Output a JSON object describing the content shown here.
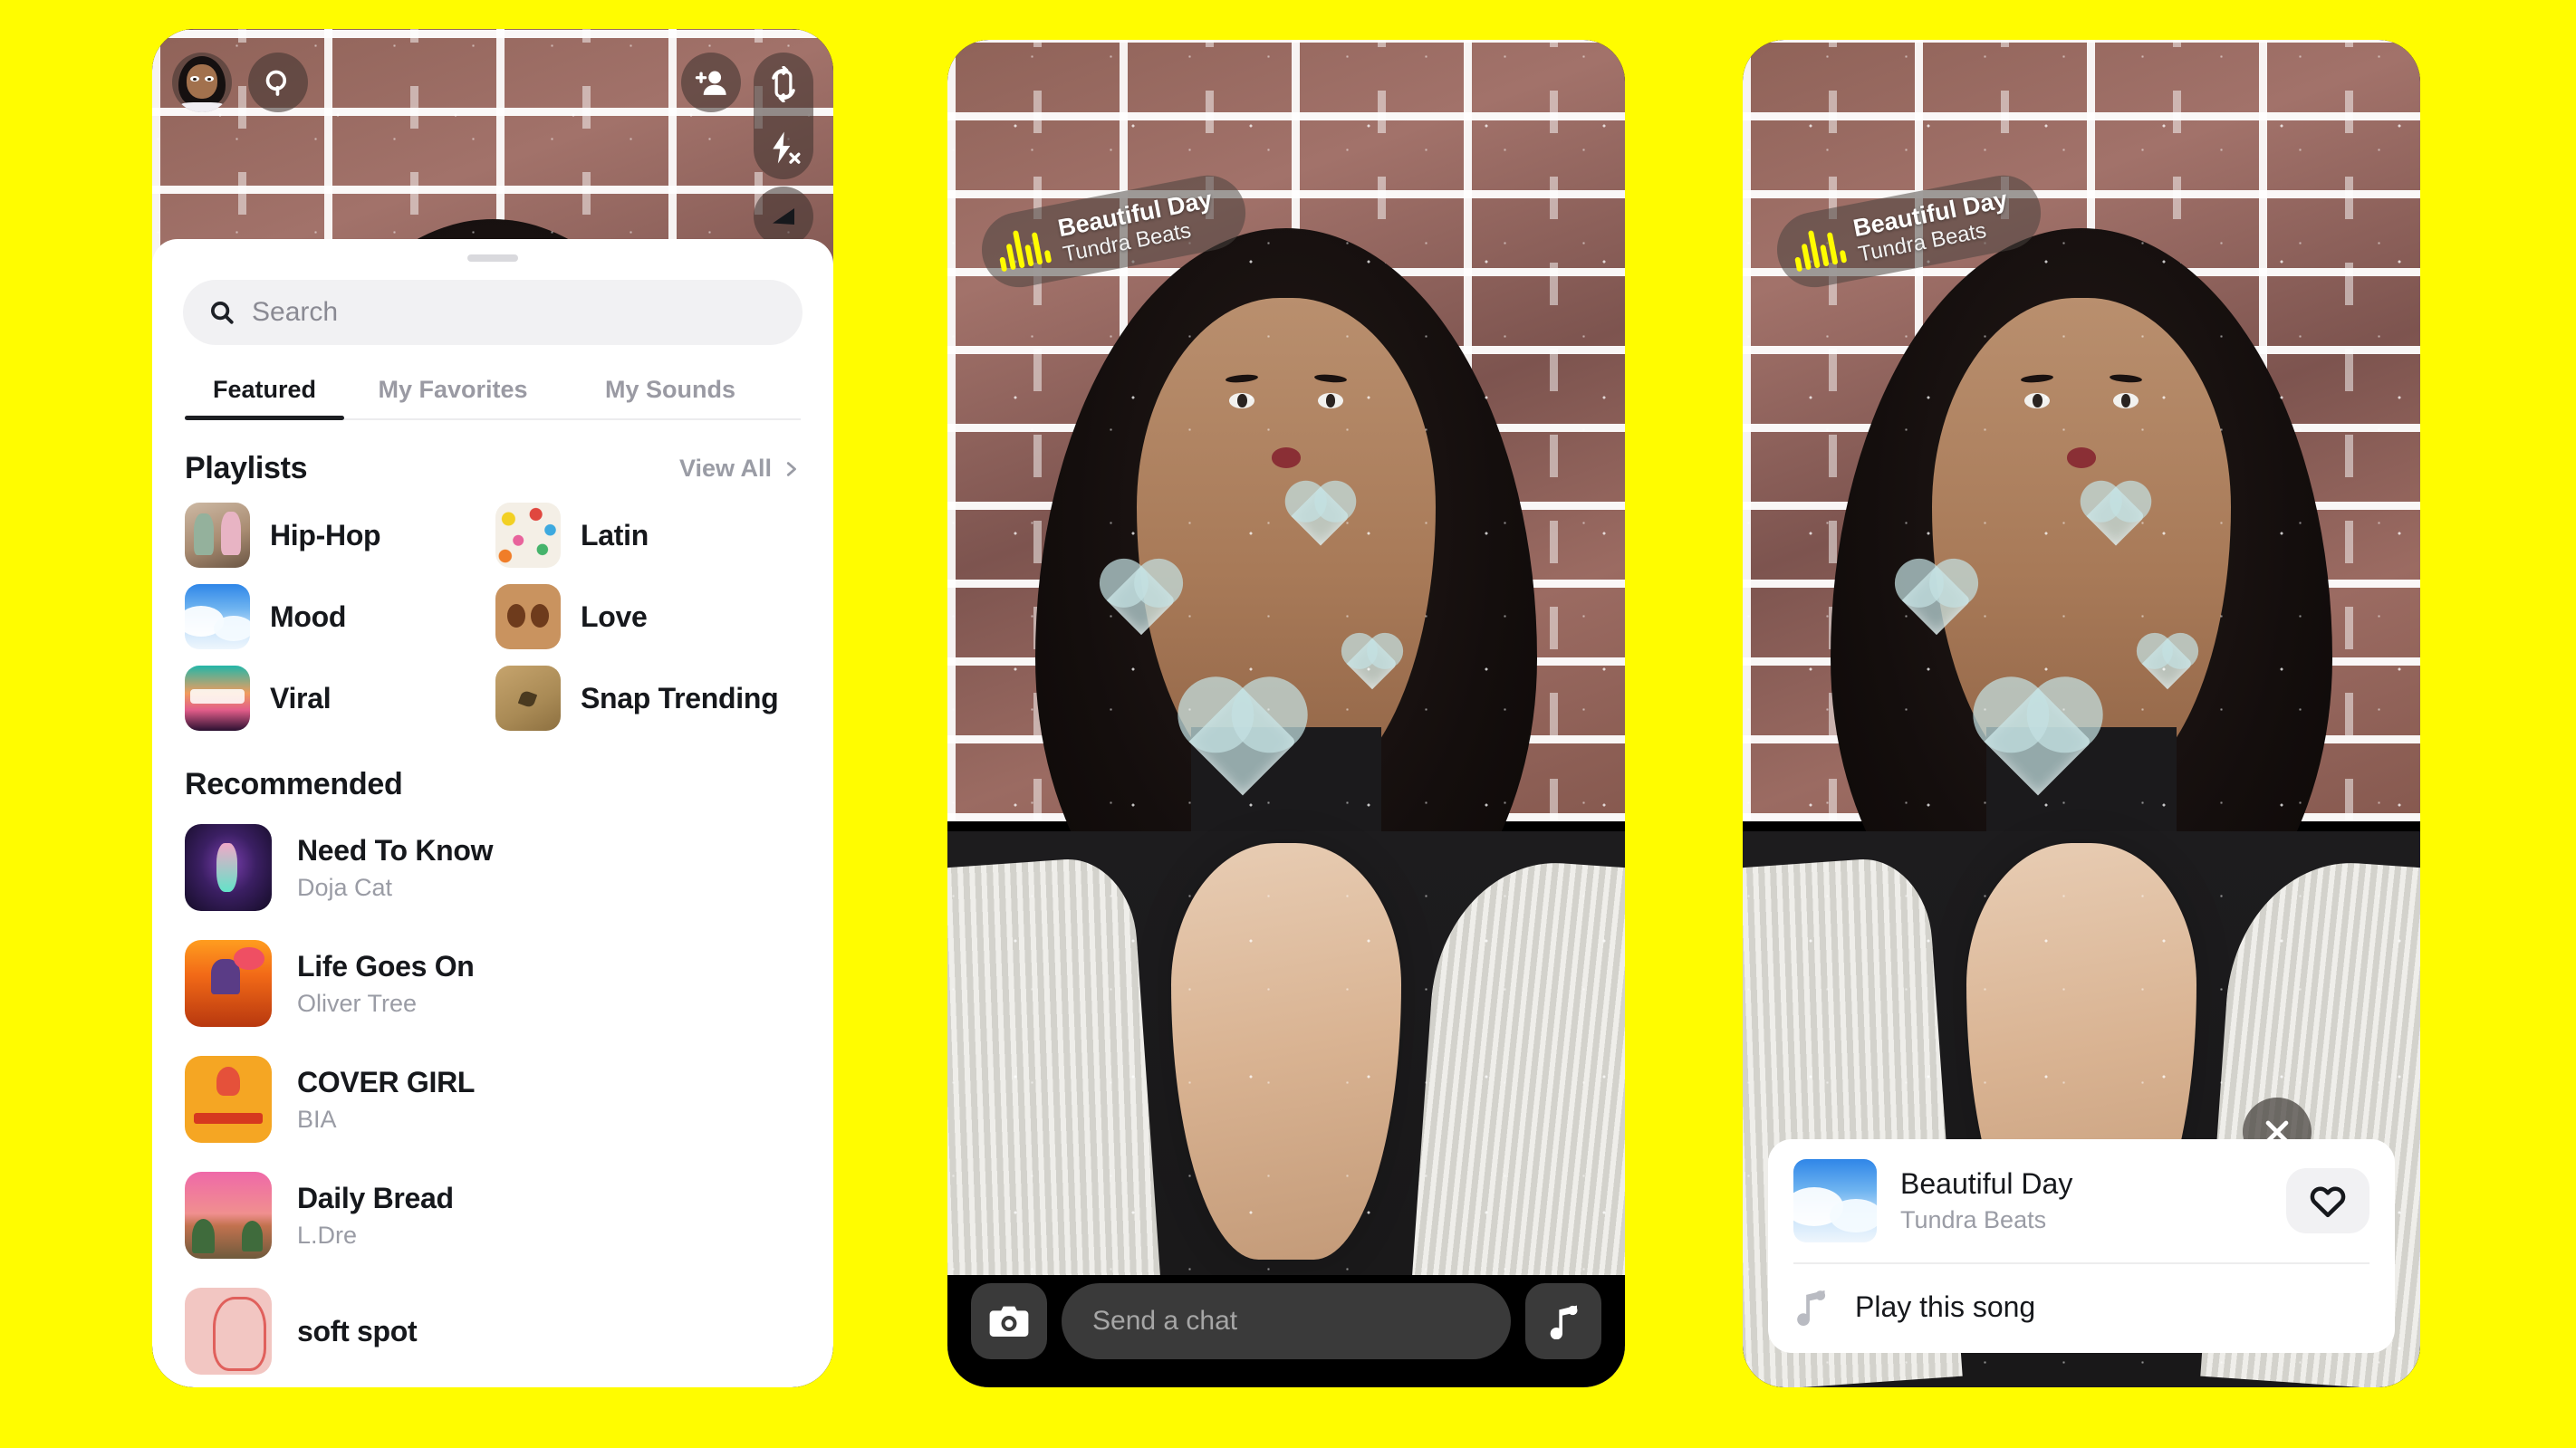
{
  "page": {
    "background_color": "#FFFC00"
  },
  "phone1": {
    "camera": {
      "avatar": "bitmoji-avatar",
      "search_icon": "search-icon",
      "add_friend_icon": "add-friend-icon",
      "flip_camera_icon": "flip-camera-icon",
      "flash_off_icon": "flash-off-icon",
      "night_mode_icon": "night-mode-icon"
    },
    "sheet": {
      "grabber": "drag-handle",
      "search": {
        "placeholder": "Search",
        "icon": "search-icon"
      },
      "tabs": [
        {
          "label": "Featured",
          "active": true
        },
        {
          "label": "My Favorites",
          "active": false
        },
        {
          "label": "My Sounds",
          "active": false
        }
      ],
      "playlists_section": {
        "title": "Playlists",
        "view_all": "View All",
        "chevron_icon": "chevron-right-icon",
        "items": [
          {
            "name": "Hip-Hop",
            "art": "art-hiphop"
          },
          {
            "name": "Latin",
            "art": "art-latin"
          },
          {
            "name": "Mood",
            "art": "art-mood"
          },
          {
            "name": "Love",
            "art": "art-love"
          },
          {
            "name": "Viral",
            "art": "art-viral"
          },
          {
            "name": "Snap Trending",
            "art": "art-snap"
          }
        ]
      },
      "recommended_section": {
        "title": "Recommended",
        "items": [
          {
            "title": "Need To Know",
            "artist": "Doja Cat",
            "art": "art-need"
          },
          {
            "title": "Life Goes On",
            "artist": "Oliver Tree",
            "art": "art-life"
          },
          {
            "title": "COVER GIRL",
            "artist": "BIA",
            "art": "art-cover"
          },
          {
            "title": "Daily Bread",
            "artist": "L.Dre",
            "art": "art-daily"
          },
          {
            "title": "soft spot",
            "artist": "",
            "art": "art-soft"
          }
        ]
      }
    }
  },
  "phone2": {
    "music_sticker": {
      "title": "Beautiful Day",
      "artist": "Tundra Beats",
      "icon": "equalizer-icon"
    },
    "chat_bar": {
      "camera_icon": "camera-icon",
      "placeholder": "Send a chat",
      "music_icon": "music-note-icon"
    }
  },
  "phone3": {
    "music_sticker": {
      "title": "Beautiful Day",
      "artist": "Tundra Beats",
      "icon": "equalizer-icon"
    },
    "close_icon": "close-icon",
    "song_sheet": {
      "title": "Beautiful Day",
      "artist": "Tundra Beats",
      "favorite_icon": "heart-icon",
      "play_icon": "music-note-icon",
      "play_label": "Play this song"
    }
  }
}
